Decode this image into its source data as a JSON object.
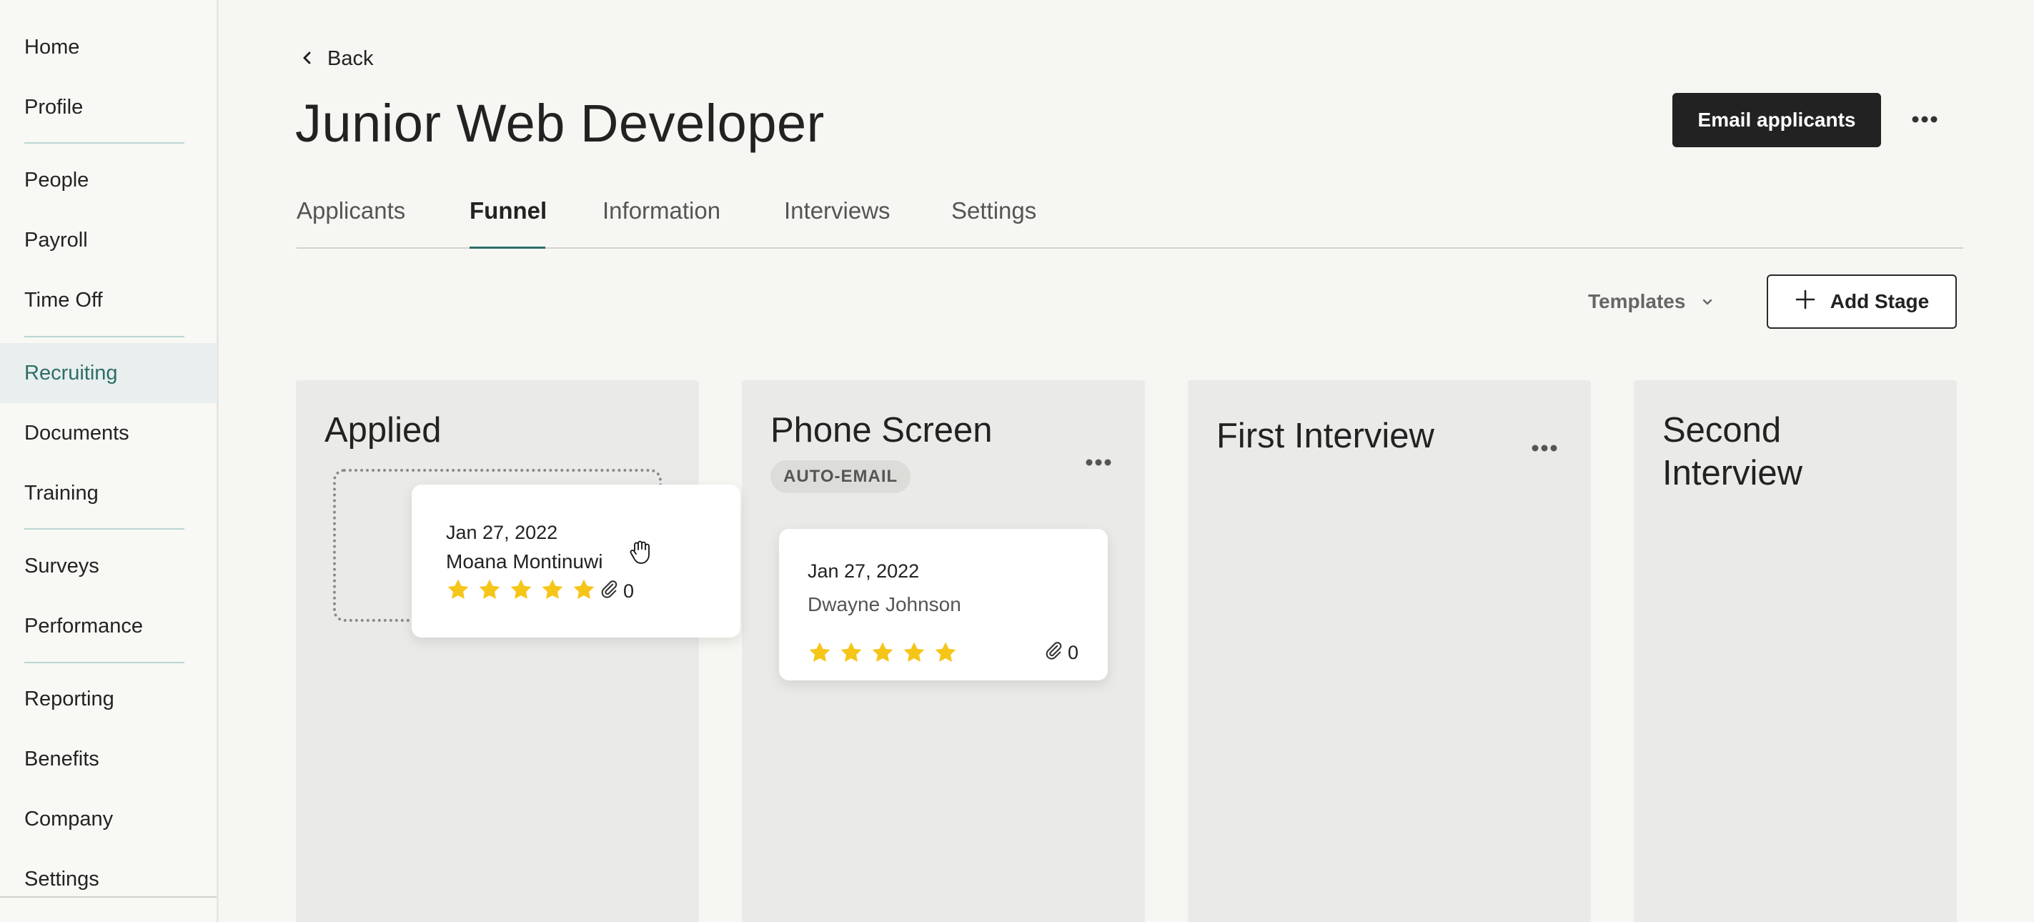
{
  "sidebar": {
    "items": [
      {
        "label": "Home",
        "active": false
      },
      {
        "label": "Profile",
        "active": false
      },
      {
        "label": "People",
        "active": false
      },
      {
        "label": "Payroll",
        "active": false
      },
      {
        "label": "Time Off",
        "active": false
      },
      {
        "label": "Recruiting",
        "active": true
      },
      {
        "label": "Documents",
        "active": false
      },
      {
        "label": "Training",
        "active": false
      },
      {
        "label": "Surveys",
        "active": false
      },
      {
        "label": "Performance",
        "active": false
      },
      {
        "label": "Reporting",
        "active": false
      },
      {
        "label": "Benefits",
        "active": false
      },
      {
        "label": "Company",
        "active": false
      },
      {
        "label": "Settings",
        "active": false
      }
    ]
  },
  "header": {
    "back_label": "Back",
    "title": "Junior Web Developer",
    "email_button": "Email applicants"
  },
  "tabs": [
    {
      "label": "Applicants",
      "active": false
    },
    {
      "label": "Funnel",
      "active": true
    },
    {
      "label": "Information",
      "active": false
    },
    {
      "label": "Interviews",
      "active": false
    },
    {
      "label": "Settings",
      "active": false
    }
  ],
  "toolbar": {
    "templates_label": "Templates",
    "add_stage_label": "Add Stage"
  },
  "columns": [
    {
      "title": "Applied"
    },
    {
      "title": "Phone Screen",
      "badge": "AUTO-EMAIL"
    },
    {
      "title": "First Interview"
    },
    {
      "title_line1": "Second",
      "title_line2": "Interview"
    }
  ],
  "cards": {
    "dragging": {
      "date": "Jan 27, 2022",
      "name": "Moana Montinuwi",
      "rating": 5,
      "attachments": "0"
    },
    "phone_screen": {
      "date": "Jan 27, 2022",
      "name": "Dwayne Johnson",
      "rating": 5,
      "attachments": "0"
    }
  },
  "colors": {
    "accent": "#2e6e68",
    "star": "#f5c518",
    "primary_button": "#222222"
  }
}
